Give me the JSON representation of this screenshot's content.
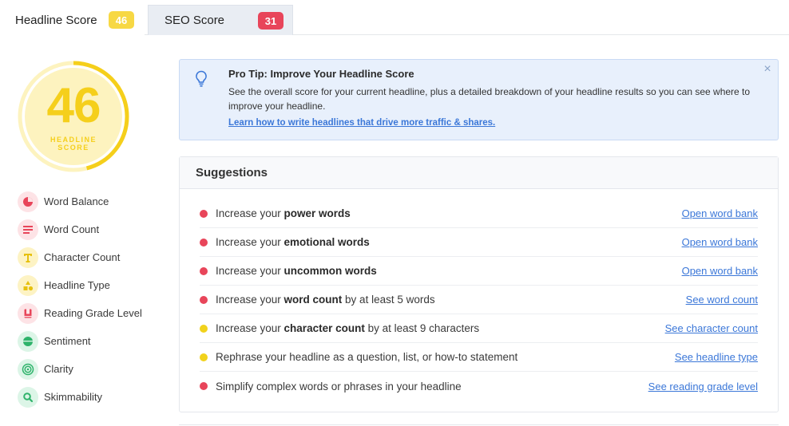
{
  "tabs": [
    {
      "label": "Headline Score",
      "badge": "46",
      "badge_color": "#f7d844",
      "active": true
    },
    {
      "label": "SEO Score",
      "badge": "31",
      "badge_color": "#e8455a",
      "active": false
    }
  ],
  "score": {
    "value": "46",
    "label_line1": "HEADLINE",
    "label_line2": "SCORE",
    "fraction": 0.46,
    "color": "#f5cf1b"
  },
  "metrics": [
    {
      "label": "Word Balance",
      "icon": "pie-chart-icon",
      "color": "red"
    },
    {
      "label": "Word Count",
      "icon": "lines-icon",
      "color": "red"
    },
    {
      "label": "Character Count",
      "icon": "text-t-icon",
      "color": "yellow"
    },
    {
      "label": "Headline Type",
      "icon": "shapes-icon",
      "color": "yellow"
    },
    {
      "label": "Reading Grade Level",
      "icon": "book-icon",
      "color": "red"
    },
    {
      "label": "Sentiment",
      "icon": "smiley-icon",
      "color": "green"
    },
    {
      "label": "Clarity",
      "icon": "target-icon",
      "color": "green"
    },
    {
      "label": "Skimmability",
      "icon": "magnifier-icon",
      "color": "green"
    }
  ],
  "tip": {
    "title": "Pro Tip: Improve Your Headline Score",
    "body": "See the overall score for your current headline, plus a detailed breakdown of your headline results so you can see where to improve your headline.",
    "link": "Learn how to write headlines that drive more traffic & shares.",
    "close": "×"
  },
  "suggestions": {
    "title": "Suggestions",
    "items": [
      {
        "color": "red",
        "pre": "Increase your ",
        "bold": "power words",
        "post": "",
        "link": "Open word bank"
      },
      {
        "color": "red",
        "pre": "Increase your ",
        "bold": "emotional words",
        "post": "",
        "link": "Open word bank"
      },
      {
        "color": "red",
        "pre": "Increase your ",
        "bold": "uncommon words",
        "post": "",
        "link": "Open word bank"
      },
      {
        "color": "red",
        "pre": "Increase your ",
        "bold": "word count",
        "post": " by at least 5 words",
        "link": "See word count"
      },
      {
        "color": "yellow",
        "pre": "Increase your ",
        "bold": "character count",
        "post": " by at least 9 characters",
        "link": "See character count"
      },
      {
        "color": "yellow",
        "pre": "Rephrase your headline as a question, list, or how-to statement",
        "bold": "",
        "post": "",
        "link": "See headline type"
      },
      {
        "color": "red",
        "pre": "Simplify complex words or phrases in your headline",
        "bold": "",
        "post": "",
        "link": "See reading grade level"
      }
    ]
  }
}
